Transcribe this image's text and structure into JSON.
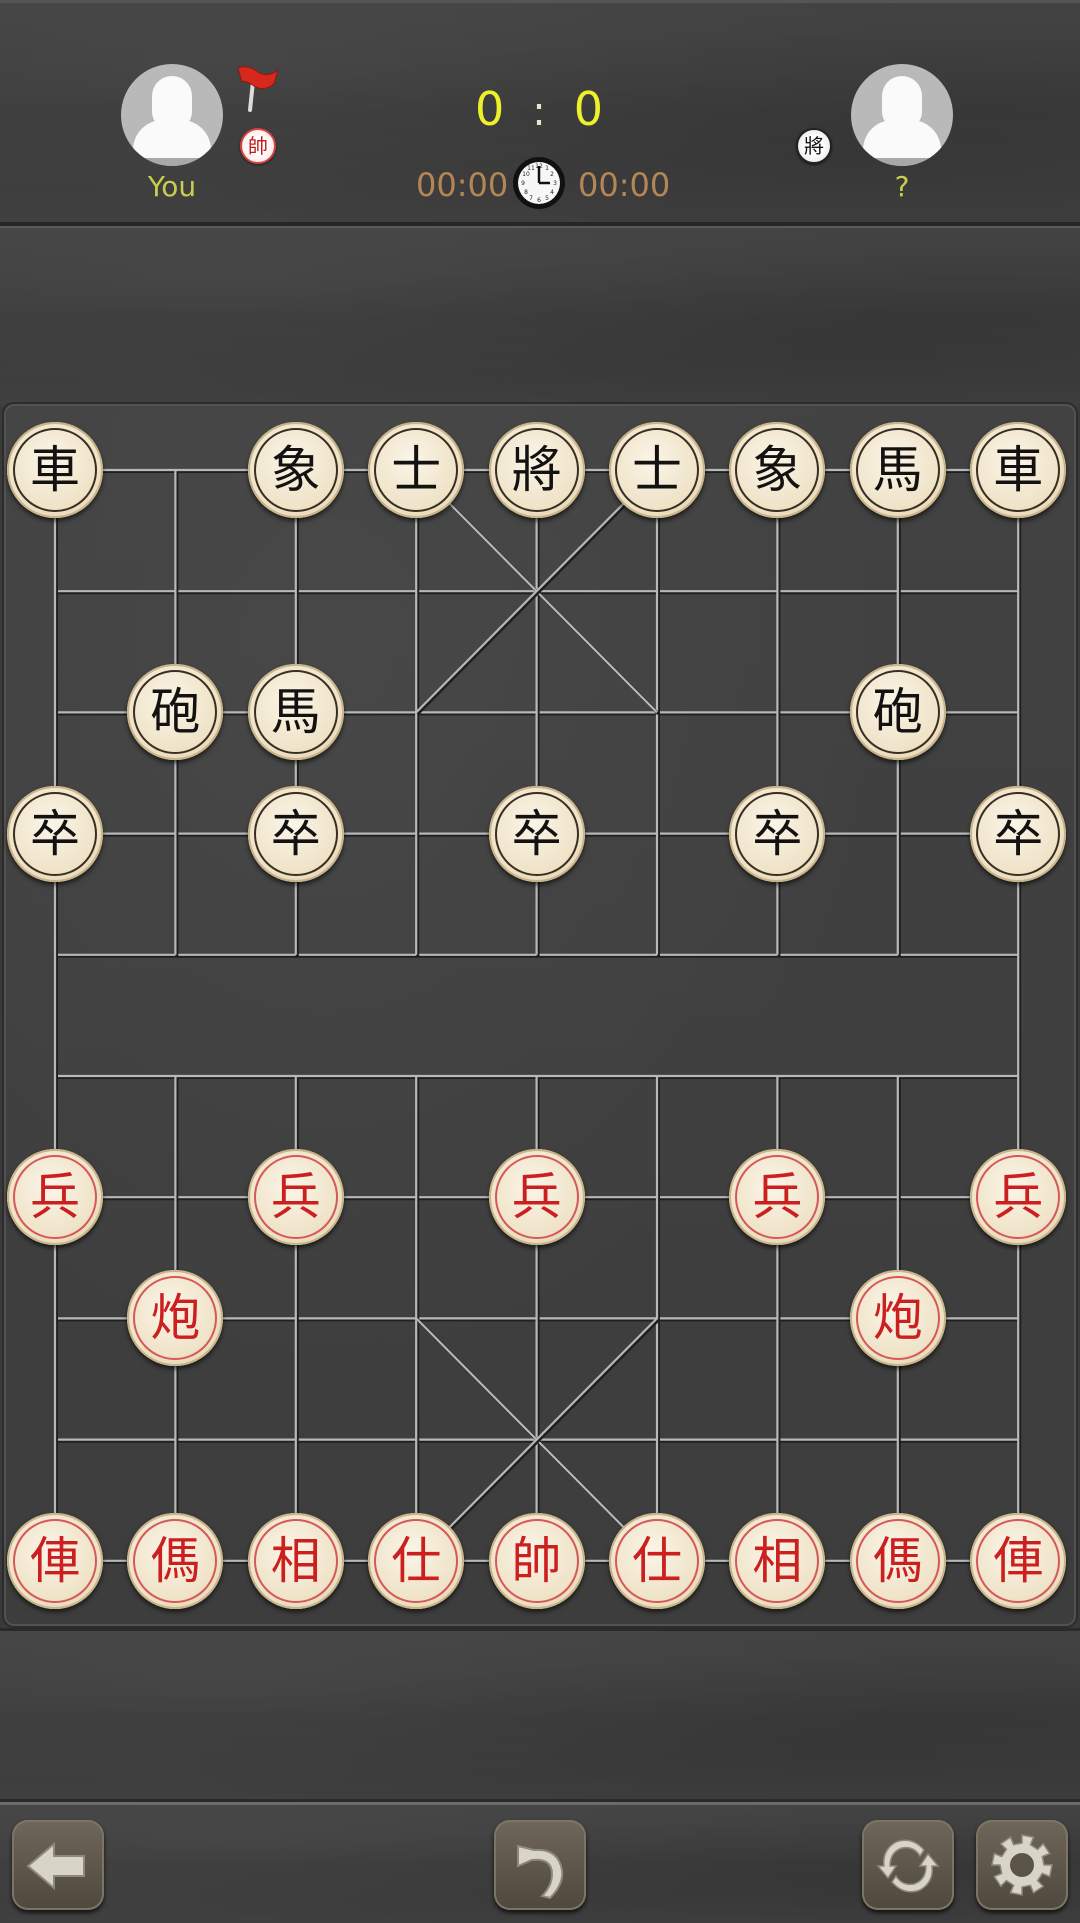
{
  "header": {
    "players": [
      {
        "name": "You",
        "side_piece": "帥",
        "side_color": "red",
        "has_flag": true
      },
      {
        "name": "?",
        "side_piece": "將",
        "side_color": "black",
        "has_flag": false
      }
    ],
    "score": {
      "left": "0",
      "separator": ":",
      "right": "0"
    },
    "timers": {
      "left": "00:00",
      "right": "00:00"
    },
    "icons": {
      "flag": "red-flag-icon",
      "clock": "clock-icon",
      "avatar": "user-avatar-icon"
    }
  },
  "board": {
    "files": 9,
    "ranks": 10,
    "pieces": [
      {
        "char": "車",
        "color": "black",
        "file": 0,
        "rank": 0
      },
      {
        "char": "象",
        "color": "black",
        "file": 2,
        "rank": 0
      },
      {
        "char": "士",
        "color": "black",
        "file": 3,
        "rank": 0
      },
      {
        "char": "將",
        "color": "black",
        "file": 4,
        "rank": 0
      },
      {
        "char": "士",
        "color": "black",
        "file": 5,
        "rank": 0
      },
      {
        "char": "象",
        "color": "black",
        "file": 6,
        "rank": 0
      },
      {
        "char": "馬",
        "color": "black",
        "file": 7,
        "rank": 0
      },
      {
        "char": "車",
        "color": "black",
        "file": 8,
        "rank": 0
      },
      {
        "char": "砲",
        "color": "black",
        "file": 1,
        "rank": 2
      },
      {
        "char": "馬",
        "color": "black",
        "file": 2,
        "rank": 2
      },
      {
        "char": "砲",
        "color": "black",
        "file": 7,
        "rank": 2
      },
      {
        "char": "卒",
        "color": "black",
        "file": 0,
        "rank": 3
      },
      {
        "char": "卒",
        "color": "black",
        "file": 2,
        "rank": 3
      },
      {
        "char": "卒",
        "color": "black",
        "file": 4,
        "rank": 3
      },
      {
        "char": "卒",
        "color": "black",
        "file": 6,
        "rank": 3
      },
      {
        "char": "卒",
        "color": "black",
        "file": 8,
        "rank": 3
      },
      {
        "char": "兵",
        "color": "red",
        "file": 0,
        "rank": 6
      },
      {
        "char": "兵",
        "color": "red",
        "file": 2,
        "rank": 6
      },
      {
        "char": "兵",
        "color": "red",
        "file": 4,
        "rank": 6
      },
      {
        "char": "兵",
        "color": "red",
        "file": 6,
        "rank": 6
      },
      {
        "char": "兵",
        "color": "red",
        "file": 8,
        "rank": 6
      },
      {
        "char": "炮",
        "color": "red",
        "file": 1,
        "rank": 7
      },
      {
        "char": "炮",
        "color": "red",
        "file": 7,
        "rank": 7
      },
      {
        "char": "俥",
        "color": "red",
        "file": 0,
        "rank": 9
      },
      {
        "char": "傌",
        "color": "red",
        "file": 1,
        "rank": 9
      },
      {
        "char": "相",
        "color": "red",
        "file": 2,
        "rank": 9
      },
      {
        "char": "仕",
        "color": "red",
        "file": 3,
        "rank": 9
      },
      {
        "char": "帥",
        "color": "red",
        "file": 4,
        "rank": 9
      },
      {
        "char": "仕",
        "color": "red",
        "file": 5,
        "rank": 9
      },
      {
        "char": "相",
        "color": "red",
        "file": 6,
        "rank": 9
      },
      {
        "char": "傌",
        "color": "red",
        "file": 7,
        "rank": 9
      },
      {
        "char": "俥",
        "color": "red",
        "file": 8,
        "rank": 9
      }
    ]
  },
  "toolbar": {
    "buttons": [
      {
        "name": "back-button",
        "icon": "arrow-left-icon"
      },
      {
        "name": "undo-button",
        "icon": "undo-icon"
      },
      {
        "name": "restart-button",
        "icon": "refresh-icon"
      },
      {
        "name": "settings-button",
        "icon": "gear-icon"
      }
    ]
  },
  "colors": {
    "score": "#eef02a",
    "timer": "#b48555",
    "player_name": "#c9cd4b",
    "red_piece": "#cc1f1f",
    "black_piece": "#141210",
    "grid_line": "#b8b8b8"
  }
}
